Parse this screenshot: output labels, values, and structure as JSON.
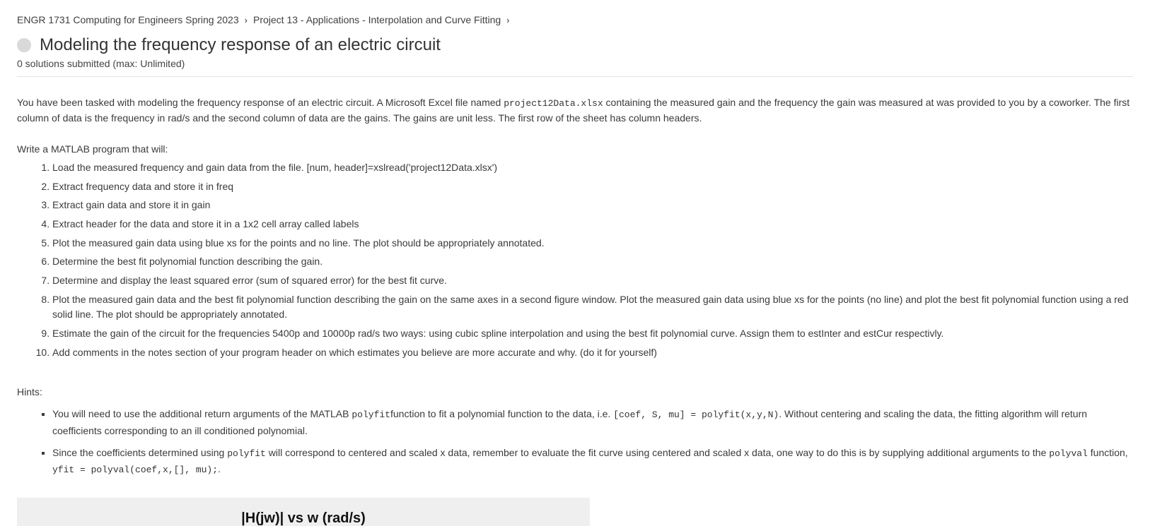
{
  "breadcrumb": {
    "course": "ENGR 1731 Computing for Engineers Spring 2023",
    "project": "Project 13 - Applications - Interpolation and Curve Fitting"
  },
  "title": "Modeling the frequency response of an electric circuit",
  "subtitle": "0 solutions submitted (max: Unlimited)",
  "intro": {
    "p1a": "You have been tasked with modeling the frequency response of an electric circuit. A Microsoft Excel file named ",
    "file": "project12Data.xlsx",
    "p1b": " containing the measured gain and the frequency the gain was measured at was provided to you by a coworker. The first column of data is the frequency in rad/s and the second column of data are the gains. The gains are unit less. The first row of the sheet has column headers."
  },
  "instruction": "Write a MATLAB program that will:",
  "steps": [
    "Load the measured frequency and gain data from the file. [num, header]=xslread('project12Data.xlsx')",
    "Extract frequency data and store it in freq",
    "Extract gain data and store it in gain",
    "Extract header for the data and store it in a 1x2 cell array called labels",
    "Plot the measured gain data using blue xs for the points and no line. The plot should be appropriately annotated.",
    "Determine the best fit polynomial function describing the gain.",
    "Determine and display the least squared error (sum of squared error) for the best fit curve.",
    "Plot the measured gain data and the best fit polynomial function describing the gain on the same axes in a second figure window. Plot the measured gain data using blue xs for the points (no line) and plot the best fit polynomial function using a red solid line. The plot should be appropriately annotated.",
    "Estimate the gain of the circuit for the frequencies 5400p and 10000p rad/s two ways: using cubic spline interpolation and using the best fit polynomial curve. Assign them to estInter  and estCur respectivly.",
    "Add comments in the notes section of your program header on which estimates you believe are more accurate and why. (do it for yourself)"
  ],
  "hints_label": "Hints:",
  "hints": {
    "h1a": "You will need to use the additional return arguments of the MATLAB ",
    "h1code1": "polyfit",
    "h1b": "function to fit a polynomial function to the data, i.e. ",
    "h1code2": "[coef, S, mu] = polyfit(x,y,N)",
    "h1c": ". Without centering and scaling the data, the fitting algorithm will return coefficients corresponding to an ill conditioned polynomial.",
    "h2a": "Since the coefficients determined using ",
    "h2code1": "polyfit",
    "h2b": " will correspond to centered and scaled x data, remember to evaluate the fit curve using centered and scaled x data, one way to do this is by supplying additional arguments to the ",
    "h2code2": "polyval",
    "h2c": " function, ",
    "h2code3": "yfit = polyval(coef,x,[], mu);",
    "h2d": "."
  },
  "figure_caption": "|H(jw)| vs w (rad/s)"
}
